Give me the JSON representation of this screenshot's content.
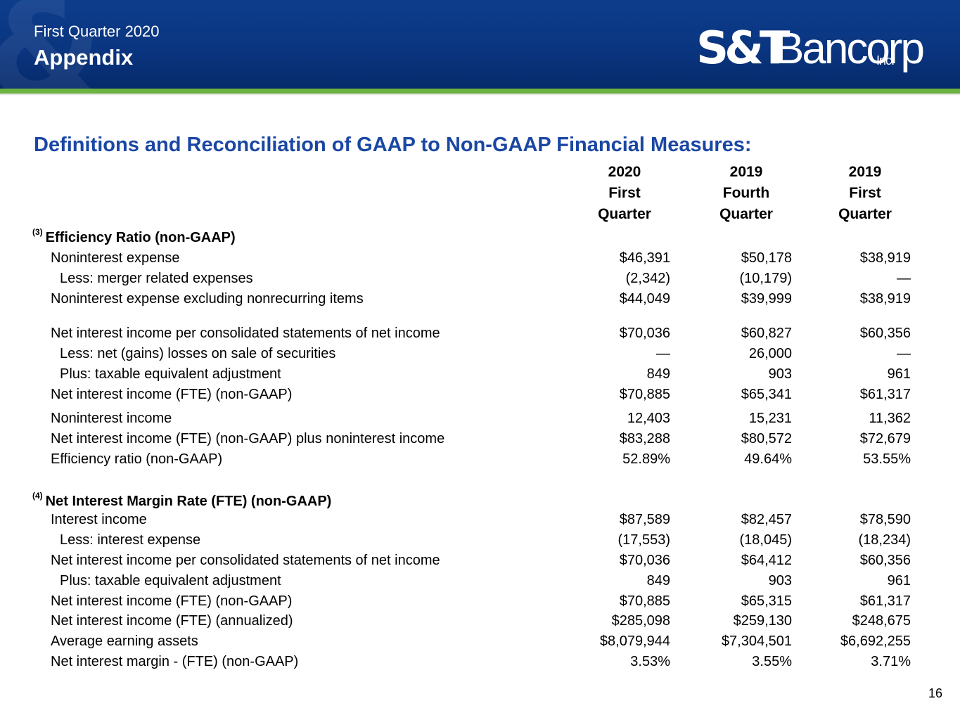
{
  "header": {
    "subtitle": "First Quarter 2020",
    "title": "Appendix",
    "logo_text": "S&TBancorp",
    "logo_suffix": "Inc."
  },
  "colors": {
    "header_bg": "#0a3580",
    "accent_green": "#6cb33f",
    "heading_blue": "#1a47a3"
  },
  "section_title": "Definitions and Reconciliation of GAAP to Non-GAAP Financial Measures:",
  "columns": [
    {
      "line1": "2020",
      "line2": "First",
      "line3": "Quarter"
    },
    {
      "line1": "2019",
      "line2": "Fourth",
      "line3": "Quarter"
    },
    {
      "line1": "2019",
      "line2": "First",
      "line3": "Quarter"
    }
  ],
  "efficiency": {
    "footnote": "(3)",
    "title": "Efficiency Ratio (non-GAAP)",
    "rows": [
      {
        "label": "Noninterest expense",
        "v": [
          "$46,391",
          "$50,178",
          "$38,919"
        ]
      },
      {
        "label": "Less: merger related expenses",
        "v": [
          "(2,342)",
          "(10,179)",
          "—"
        ]
      },
      {
        "label": "Noninterest expense excluding nonrecurring items",
        "v": [
          "$44,049",
          "$39,999",
          "$38,919"
        ]
      },
      {
        "label": "Net interest income per consolidated statements of net income",
        "v": [
          "$70,036",
          "$60,827",
          "$60,356"
        ]
      },
      {
        "label": "Less: net (gains) losses on sale of securities",
        "v": [
          "—",
          "26,000",
          "—"
        ]
      },
      {
        "label": "Plus: taxable equivalent adjustment",
        "v": [
          "849",
          "903",
          "961"
        ]
      },
      {
        "label": "Net interest income (FTE) (non-GAAP)",
        "v": [
          "$70,885",
          "$65,341",
          "$61,317"
        ]
      },
      {
        "label": "Noninterest income",
        "v": [
          "12,403",
          "15,231",
          "11,362"
        ]
      },
      {
        "label": "Net interest income (FTE) (non-GAAP) plus noninterest income",
        "v": [
          "$83,288",
          "$80,572",
          "$72,679"
        ]
      },
      {
        "label": "Efficiency ratio (non-GAAP)",
        "v": [
          "52.89%",
          "49.64%",
          "53.55%"
        ]
      }
    ]
  },
  "nim": {
    "footnote": "(4)",
    "title": "Net Interest Margin Rate (FTE) (non-GAAP)",
    "rows": [
      {
        "label": "Interest income",
        "v": [
          "$87,589",
          "$82,457",
          "$78,590"
        ]
      },
      {
        "label": "Less: interest expense",
        "v": [
          "(17,553)",
          "(18,045)",
          "(18,234)"
        ]
      },
      {
        "label": "Net interest income per consolidated statements of net income",
        "v": [
          "$70,036",
          "$64,412",
          "$60,356"
        ]
      },
      {
        "label": "Plus: taxable equivalent adjustment",
        "v": [
          "849",
          "903",
          "961"
        ]
      },
      {
        "label": "Net interest income (FTE) (non-GAAP)",
        "v": [
          "$70,885",
          "$65,315",
          "$61,317"
        ]
      },
      {
        "label": "Net interest income (FTE) (annualized)",
        "v": [
          "$285,098",
          "$259,130",
          "$248,675"
        ]
      },
      {
        "label": "Average earning assets",
        "v": [
          "$8,079,944",
          "$7,304,501",
          "$6,692,255"
        ]
      },
      {
        "label": "Net interest margin - (FTE) (non-GAAP)",
        "v": [
          "3.53%",
          "3.55%",
          "3.71%"
        ]
      }
    ]
  },
  "page_number": "16"
}
